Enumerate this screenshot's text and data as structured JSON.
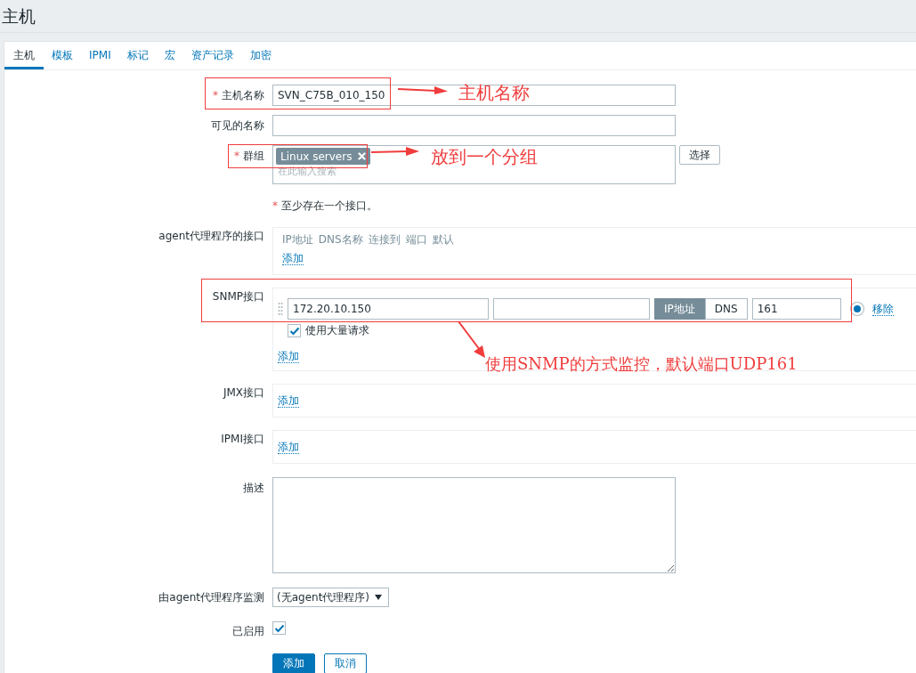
{
  "page_title": "主机",
  "tabs": [
    {
      "label": "主机",
      "selected": true
    },
    {
      "label": "模板",
      "selected": false
    },
    {
      "label": "IPMI",
      "selected": false
    },
    {
      "label": "标记",
      "selected": false
    },
    {
      "label": "宏",
      "selected": false
    },
    {
      "label": "资产记录",
      "selected": false
    },
    {
      "label": "加密",
      "selected": false
    }
  ],
  "host_name": {
    "label": "主机名称",
    "required_mark": "*",
    "value": "SVN_C75B_010_150"
  },
  "visible_name": {
    "label": "可见的名称"
  },
  "groups": {
    "label": "群组",
    "required_mark": "*",
    "tags": [
      "Linux servers"
    ],
    "placeholder": "在此输入搜索",
    "select_button": "选择"
  },
  "interface_note": {
    "required_mark": "*",
    "text": "至少存在一个接口。"
  },
  "agent_interfaces": {
    "label": "agent代理程序的接口",
    "columns": [
      "IP地址",
      "DNS名称",
      "连接到",
      "端口",
      "默认"
    ],
    "add_link": "添加"
  },
  "snmp_interfaces": {
    "label": "SNMP接口",
    "rows": [
      {
        "ip": "172.20.10.150",
        "dns": "",
        "connect_to": [
          {
            "label": "IP地址",
            "selected": true
          },
          {
            "label": "DNS",
            "selected": false
          }
        ],
        "port": "161",
        "default": true,
        "remove_link": "移除",
        "bulk": {
          "label": "使用大量请求",
          "checked": true
        }
      }
    ],
    "add_link": "添加"
  },
  "jmx_interfaces": {
    "label": "JMX接口",
    "add_link": "添加"
  },
  "ipmi_interfaces": {
    "label": "IPMI接口",
    "add_link": "添加"
  },
  "description": {
    "label": "描述"
  },
  "proxy": {
    "label": "由agent代理程序监测",
    "value": "(无agent代理程序)"
  },
  "enabled": {
    "label": "已启用",
    "checked": true
  },
  "buttons": [
    {
      "label": "添加",
      "kind": "primary"
    },
    {
      "label": "取消",
      "kind": "secondary"
    }
  ],
  "annotations": [
    {
      "text": "主机名称"
    },
    {
      "text": "放到一个分组"
    },
    {
      "text": "使用SNMP的方式监控，默认端口UDP161"
    }
  ]
}
